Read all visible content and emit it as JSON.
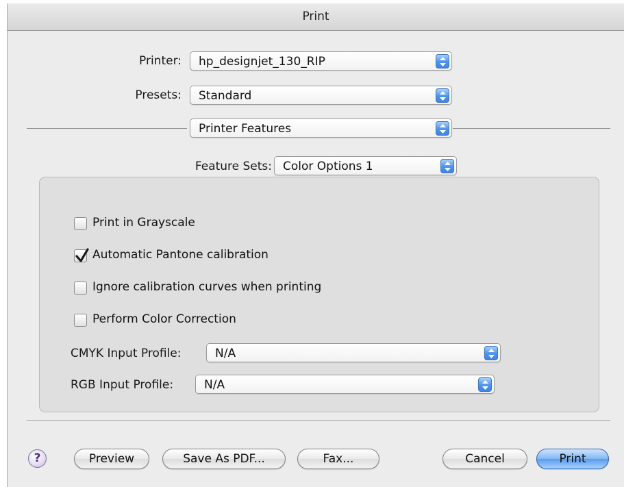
{
  "window": {
    "title": "Print"
  },
  "printer": {
    "label": "Printer:",
    "value": "hp_designjet_130_RIP"
  },
  "presets": {
    "label": "Presets:",
    "value": "Standard"
  },
  "pane": {
    "value": "Printer Features"
  },
  "feature_sets": {
    "label": "Feature Sets:",
    "value": "Color Options 1"
  },
  "options": {
    "grayscale": {
      "label": "Print in Grayscale",
      "checked": false
    },
    "pantone": {
      "label": "Automatic Pantone calibration",
      "checked": true
    },
    "ignore_curves": {
      "label": "Ignore calibration curves when printing",
      "checked": false
    },
    "color_correction": {
      "label": "Perform Color Correction",
      "checked": false
    }
  },
  "cmyk_profile": {
    "label": "CMYK Input Profile:",
    "value": "N/A"
  },
  "rgb_profile": {
    "label": "RGB Input Profile:",
    "value": "N/A"
  },
  "buttons": {
    "help": "?",
    "preview": "Preview",
    "save_pdf": "Save As PDF...",
    "fax": "Fax...",
    "cancel": "Cancel",
    "print": "Print"
  },
  "colors": {
    "accent": "#4b93ea",
    "window_bg": "#ececec",
    "panel_bg": "#dfdfdf"
  }
}
